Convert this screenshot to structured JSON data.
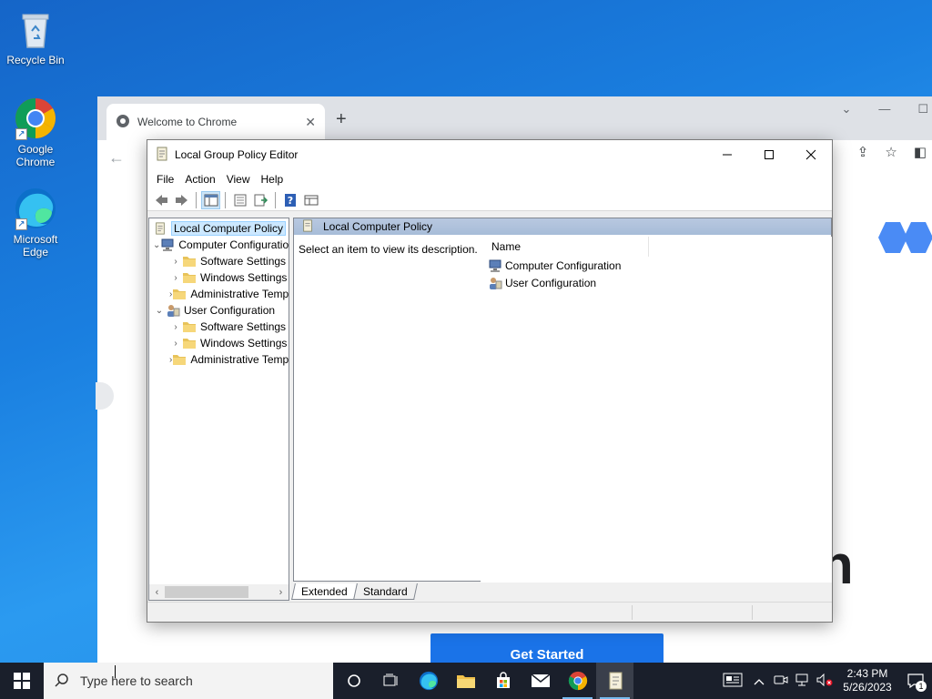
{
  "desktop": {
    "icons": [
      {
        "label": "Recycle Bin",
        "icon": "recycle-bin-icon"
      },
      {
        "label": "Google\nChrome",
        "icon": "chrome-icon"
      },
      {
        "label": "Microsoft\nEdge",
        "icon": "edge-icon"
      }
    ]
  },
  "chrome": {
    "tab_title": "Welcome to Chrome",
    "tab_close": "✕",
    "new_tab": "+",
    "get_started": "Get Started",
    "big_letter": "n"
  },
  "gpedit": {
    "title": "Local Group Policy Editor",
    "menu": [
      "File",
      "Action",
      "View",
      "Help"
    ],
    "tree": [
      {
        "label": "Local Computer Policy",
        "level": 0,
        "expander": "",
        "icon": "policy",
        "selected": true
      },
      {
        "label": "Computer Configuration",
        "level": 1,
        "expander": "⌄",
        "icon": "computer",
        "selected": false
      },
      {
        "label": "Software Settings",
        "level": 2,
        "expander": "›",
        "icon": "folder",
        "selected": false
      },
      {
        "label": "Windows Settings",
        "level": 2,
        "expander": "›",
        "icon": "folder",
        "selected": false
      },
      {
        "label": "Administrative Templates",
        "level": 2,
        "expander": "›",
        "icon": "folder",
        "selected": false
      },
      {
        "label": "User Configuration",
        "level": 1,
        "expander": "⌄",
        "icon": "user",
        "selected": false
      },
      {
        "label": "Software Settings",
        "level": 2,
        "expander": "›",
        "icon": "folder",
        "selected": false
      },
      {
        "label": "Windows Settings",
        "level": 2,
        "expander": "›",
        "icon": "folder",
        "selected": false
      },
      {
        "label": "Administrative Templates",
        "level": 2,
        "expander": "›",
        "icon": "folder",
        "selected": false
      }
    ],
    "right_header": "Local Computer Policy",
    "description": "Select an item to view its description.",
    "column_name": "Name",
    "items": [
      {
        "label": "Computer Configuration",
        "icon": "computer"
      },
      {
        "label": "User Configuration",
        "icon": "user"
      }
    ],
    "tabs": [
      "Extended",
      "Standard"
    ]
  },
  "taskbar": {
    "search_placeholder": "Type here to search",
    "time": "2:43 PM",
    "date": "5/26/2023",
    "notification_count": "1"
  },
  "colors": {
    "accent": "#1a73e8",
    "taskbar": "#1a1f2b"
  }
}
